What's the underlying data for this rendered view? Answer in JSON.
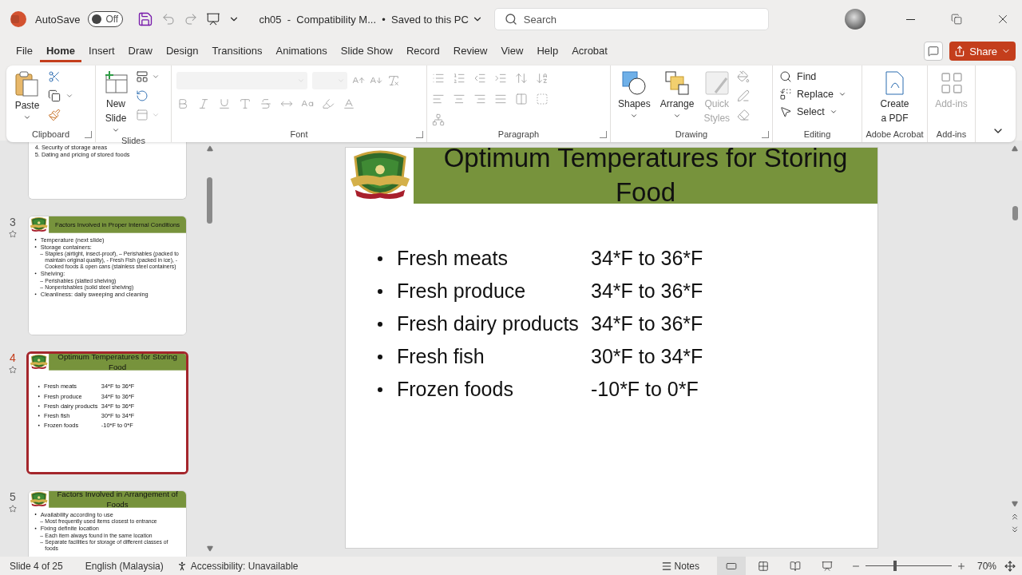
{
  "titlebar": {
    "autosave": "AutoSave",
    "autosave_on": false,
    "autosave_state": "Off",
    "document": "ch05  -  Compatibility M...  •  Saved to this PC",
    "search": {
      "placeholder": "Search"
    }
  },
  "tabs": [
    {
      "label": "File",
      "selected": false
    },
    {
      "label": "Home",
      "selected": true
    },
    {
      "label": "Insert",
      "selected": false
    },
    {
      "label": "Draw",
      "selected": false
    },
    {
      "label": "Design",
      "selected": false
    },
    {
      "label": "Transitions",
      "selected": false
    },
    {
      "label": "Animations",
      "selected": false
    },
    {
      "label": "Slide Show",
      "selected": false
    },
    {
      "label": "Record",
      "selected": false
    },
    {
      "label": "Review",
      "selected": false
    },
    {
      "label": "View",
      "selected": false
    },
    {
      "label": "Help",
      "selected": false
    },
    {
      "label": "Acrobat",
      "selected": false
    }
  ],
  "share": "Share",
  "ribbon": [
    {
      "kind": "clipboard",
      "label": "Clipboard",
      "launcher": true,
      "disabled": false,
      "buttons": [
        {
          "lines": [
            "Paste"
          ],
          "disabled": false
        }
      ]
    },
    {
      "kind": "slides",
      "label": "Slides",
      "launcher": false,
      "disabled": false,
      "buttons": [
        {
          "lines": [
            "New",
            "Slide"
          ],
          "disabled": false
        }
      ]
    },
    {
      "kind": "font",
      "label": "Font",
      "launcher": true,
      "disabled": true
    },
    {
      "kind": "paragraph",
      "label": "Paragraph",
      "launcher": true,
      "disabled": true
    },
    {
      "kind": "drawing",
      "label": "Drawing",
      "launcher": true,
      "disabled": false,
      "buttons": [
        {
          "lines": [
            "Shapes"
          ],
          "disabled": false
        },
        {
          "lines": [
            "Arrange"
          ],
          "disabled": false
        },
        {
          "lines": [
            "Quick",
            "Styles"
          ],
          "disabled": true
        }
      ]
    },
    {
      "kind": "editing",
      "label": "Editing",
      "launcher": false,
      "disabled": false,
      "buttons": [
        {
          "lines": [
            "Find"
          ],
          "disabled": false
        },
        {
          "lines": [
            "Replace"
          ],
          "disabled": false
        },
        {
          "lines": [
            "Select"
          ],
          "disabled": false
        }
      ]
    },
    {
      "kind": "acrobat",
      "label": "Adobe Acrobat",
      "launcher": false,
      "disabled": false,
      "buttons": [
        {
          "lines": [
            "Create",
            "a PDF"
          ],
          "disabled": false
        }
      ]
    },
    {
      "kind": "addins",
      "label": "Add-ins",
      "launcher": false,
      "disabled": false,
      "buttons": [
        {
          "lines": [
            "Add-ins"
          ],
          "disabled": true
        }
      ]
    }
  ],
  "thumbnails": [
    {
      "kind": "numbered",
      "animated": false,
      "selected": false,
      "lines": [
        {
          "text": "4.   Security of storage areas"
        },
        {
          "text": "5.   Dating and pricing of stored foods"
        }
      ]
    },
    {
      "kind": "outline",
      "number": "3",
      "animated": true,
      "selected": false,
      "title": "Factors Involved in Proper Internal Conditions",
      "lines": [
        {
          "text": "Temperature (next slide)"
        },
        {
          "text": "Storage containers:",
          "children": [
            {
              "marker": "–",
              "text": "Staples (airtight, insect-proof), – Perishables (packed to maintain original quality), -  Fresh Fish (packed in ice), - Cooked foods & open cans (stainless steel containers)"
            }
          ]
        },
        {
          "text": "Shelving:",
          "children": [
            {
              "marker": "–",
              "text": "Perishables (slatted shelving)"
            },
            {
              "marker": "–",
              "text": "Nonperishables (solid steel shelving)"
            }
          ]
        },
        {
          "text": "Cleanliness: daily sweeping and cleaning"
        }
      ]
    },
    {
      "kind": "temps",
      "number": "4",
      "animated": true,
      "selected": true,
      "title": "Optimum Temperatures for Storing Food",
      "items": [
        {
          "name": "Fresh meats",
          "range": "34*F to 36*F"
        },
        {
          "name": "Fresh produce",
          "range": "34*F to 36*F"
        },
        {
          "name": "Fresh dairy products",
          "range": "34*F to 36*F"
        },
        {
          "name": "Fresh fish",
          "range": "30*F to 34*F"
        },
        {
          "name": "Frozen foods",
          "range": "-10*F to 0*F"
        }
      ]
    },
    {
      "kind": "outline",
      "number": "5",
      "animated": true,
      "selected": false,
      "title": "Factors Involved in Arrangement of Foods",
      "lines": [
        {
          "text": "Availability according to use",
          "children": [
            {
              "marker": "–",
              "text": "Most frequently used items closest to entrance"
            }
          ]
        },
        {
          "text": "Fixing definite location",
          "children": [
            {
              "marker": "–",
              "text": "Each item always found in the same location"
            },
            {
              "marker": "–",
              "text": "Separate facilities for storage of different classes of foods"
            }
          ]
        }
      ]
    }
  ],
  "slide": {
    "kind": "temps",
    "title": "Optimum Temperatures for Storing Food",
    "items": [
      {
        "name": "Fresh meats",
        "range": "34*F to 36*F"
      },
      {
        "name": "Fresh produce",
        "range": "34*F to 36*F"
      },
      {
        "name": "Fresh dairy products",
        "range": "34*F to 36*F"
      },
      {
        "name": "Fresh fish",
        "range": "30*F to 34*F"
      },
      {
        "name": "Frozen foods",
        "range": "-10*F to 0*F"
      }
    ]
  },
  "status": {
    "slide_position": "Slide 4 of 25",
    "language": "English (Malaysia)",
    "accessibility": "Accessibility: Unavailable",
    "notes": "Notes",
    "views": [
      {
        "selected": true
      },
      {
        "selected": false
      },
      {
        "selected": false
      },
      {
        "selected": false
      }
    ],
    "zoom": {
      "level": 0.34,
      "reading": "70%"
    }
  }
}
